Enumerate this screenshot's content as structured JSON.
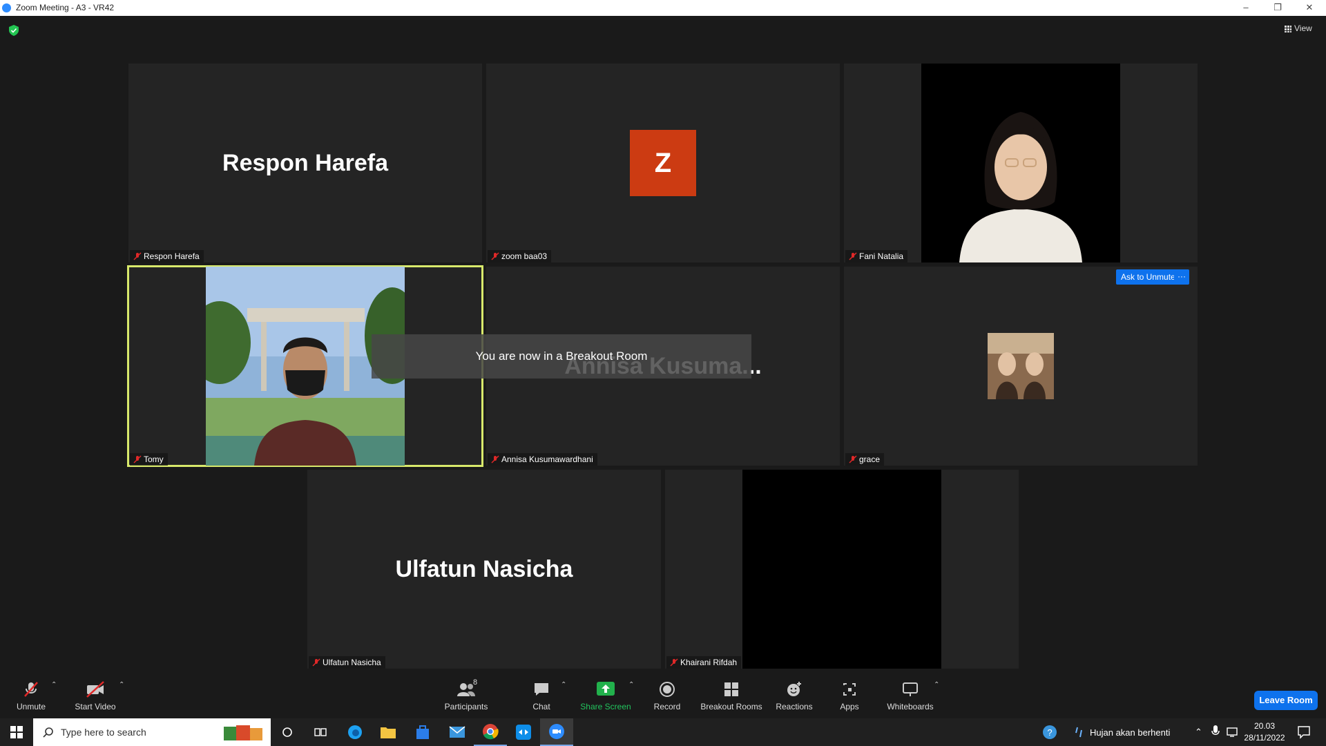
{
  "window": {
    "title": "Zoom Meeting - A3 - VR42"
  },
  "view": {
    "label": "View"
  },
  "tiles": [
    {
      "display_name": "Respon Harefa",
      "label": "Respon Harefa"
    },
    {
      "display_name": "Z",
      "label": "zoom baa03"
    },
    {
      "display_name": "",
      "label": "Fani Natalia"
    },
    {
      "display_name": "",
      "label": "Tomy"
    },
    {
      "display_name": "Annisa  Kusuma...",
      "label": "Annisa Kusumawardhani"
    },
    {
      "display_name": "",
      "label": "grace"
    },
    {
      "display_name": "Ulfatun Nasicha",
      "label": "Ulfatun Nasicha"
    },
    {
      "display_name": "",
      "label": "Khairani Rifdah"
    }
  ],
  "toast": {
    "text": "You are now in a Breakout Room"
  },
  "ask_unmute": {
    "label": "Ask to Unmute",
    "more": "···"
  },
  "toolbar": {
    "unmute": "Unmute",
    "start_video": "Start Video",
    "participants": "Participants",
    "participants_count": "8",
    "chat": "Chat",
    "share_screen": "Share Screen",
    "record": "Record",
    "breakout_rooms": "Breakout Rooms",
    "reactions": "Reactions",
    "apps": "Apps",
    "whiteboards": "Whiteboards",
    "leave": "Leave Room"
  },
  "taskbar": {
    "search_placeholder": "Type here to search",
    "weather": "Hujan akan berhenti",
    "time": "20.03",
    "date": "28/11/2022"
  },
  "colors": {
    "accent": "#0e72ed",
    "active_speaker": "#d8e96b",
    "avatar_z": "#cc3b12",
    "share_green": "#22b14c"
  }
}
